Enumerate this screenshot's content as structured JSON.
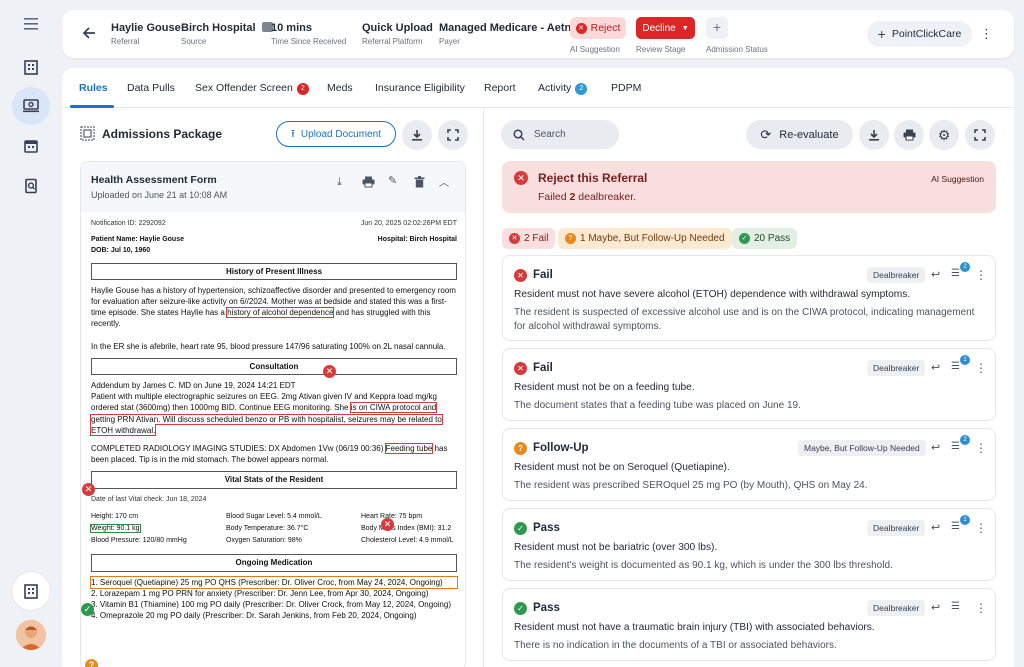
{
  "header": {
    "patient_name": "Haylie Gouse",
    "patient_label": "Referral",
    "hospital": "Birch Hospital",
    "hospital_label": "Source",
    "time": "10 mins",
    "time_label": "Time Since Received",
    "platform": "Quick Upload",
    "platform_label": "Referral Platform",
    "payer": "Managed Medicare - Aetna",
    "payer_label": "Payer",
    "ai_btn": "Reject",
    "ai_label": "AI Suggestion",
    "review_btn": "Decline",
    "review_label": "Review Stage",
    "admission_label": "Admission Status",
    "pcc_btn": "PointClickCare"
  },
  "tabs": [
    {
      "label": "Rules"
    },
    {
      "label": "Data Pulls"
    },
    {
      "label": "Sex Offender Screen",
      "badge": "2"
    },
    {
      "label": "Meds"
    },
    {
      "label": "Insurance Eligibility"
    },
    {
      "label": "Report"
    },
    {
      "label": "Activity",
      "badge": "2"
    },
    {
      "label": "PDPM"
    }
  ],
  "left": {
    "title": "Admissions Package",
    "upload_btn": "Upload Document",
    "doc_title": "Health Assessment Form",
    "doc_sub": "Uploaded on June 21 at 10:08 AM",
    "doc": {
      "notification": "Notification ID: 2292092",
      "datetime": "Jun 20, 2025 02:02:26PM EDT",
      "patient_name": "Patient Name: Haylie Gouse",
      "hospital": "Hospital: Birch Hospital",
      "dob": "DOB: Jul 10, 1960",
      "hpi_title": "History of Present Illness",
      "hpi_1": "Haylie Gouse has a history of hypertension, schizoaffective disorder and presented to emergency room for evaluation after seizure-like activity on 6/",
      "hpi_2": "/2024. Mother was at bedside and stated this was a first-time episode. She states Haylie has a",
      "hpi_hl": "history of alcohol dependence",
      "hpi_3": "and has struggled with this recently.",
      "hpi_4": "In the ER she is afebrile, heart rate 95, blood pressure 147/96 saturating 100% on 2L nasal cannula.",
      "cons_title": "Consultation",
      "cons_1": "Addendum by James C. MD on June 19, 2024 14:21 EDT",
      "cons_2": "Patient with multiple electrographic seizures on EEG. 2mg Ativan given IV and Keppra load",
      "cons_3": "mg/kg ordered stat (3600mg) then 1000mg BID. Continue EEG monitoring. She",
      "cons_hl": "is on CIWA protocol and getting PRN Ativan. Will discuss scheduled benzo or PB with hospitalist, seizures may be related to ETOH withdrawal.",
      "rad_1": "COMPLETED RADIOLOGY IMAGING STUDIES: DX Abdomen 1Vw (06/19 00:36)",
      "rad_hl": "Feeding tube",
      "rad_2": "has been placed. Tip is in the mid stomach. The bowel appears normal.",
      "vitals_title": "Vital Stats of the Resident",
      "vitals_date": "Date of last Vital check: Jun 18, 2024",
      "height": "Height: 170 cm",
      "blood_sugar": "Blood Sugar Level: 5.4 mmol/L",
      "heart_rate": "Heart Rate: 75 bpm",
      "weight": "Weight: 90.1 kg",
      "body_temp": "Body Temperature: 36.7°C",
      "bmi": "Body Mass Index (BMI): 31.2",
      "bp": "Blood Pressure: 120/80 mmHg",
      "o2": "Oxygen Saturation: 98%",
      "chol": "Cholesterol Level: 4.9 mmol/L",
      "meds_title": "Ongoing Medication",
      "med_1": "1. Seroquel (Quetiapine) 25 mg PO QHS (Prescriber: Dr. Oliver Croc, from May 24, 2024, Ongoing)",
      "med_2": "2. Lorazepam 1 mg PO PRN for anxiety (Prescriber: Dr. Jenn Lee, from Apr 30, 2024, Ongoing)",
      "med_3": "3. Vitamin B1 (Thiamine) 100 mg PO daily (Prescriber: Dr. Oliver Crock, from May 12, 2024, Ongoing)",
      "med_4": "4. Omeprazole 20 mg PO daily (Prescriber: Dr. Sarah Jenkins, from Feb 20, 2024, Ongoing)"
    }
  },
  "right": {
    "search_placeholder": "Search",
    "reeval_btn": "Re-evaluate",
    "banner_title": "Reject this Referral",
    "banner_sub_pre": "Failed ",
    "banner_sub_num": "2",
    "banner_sub_post": " dealbreaker.",
    "banner_tag": "AI Suggestion",
    "chips": [
      "2 Fail",
      "1 Maybe, But Follow-Up Needed",
      "20 Pass"
    ],
    "rules": [
      {
        "status": "Fail",
        "tag": "Dealbreaker",
        "count": "2",
        "rule": "Resident must not have severe alcohol (ETOH) dependence with withdrawal symptoms.",
        "explanation": "The resident is suspected of excessive alcohol use and is on the CIWA protocol, indicating management for alcohol withdrawal symptoms."
      },
      {
        "status": "Fail",
        "tag": "Dealbreaker",
        "count": "1",
        "rule": "Resident must not be on a feeding tube.",
        "explanation": "The document states that a feeding tube was placed on June 19."
      },
      {
        "status": "Follow-Up",
        "tag": "Maybe, But Follow-Up Needed",
        "count": "2",
        "rule": "Resident must not be on Seroquel (Quetiapine).",
        "explanation": "The resident was prescribed SEROquel 25 mg PO (by Mouth), QHS on May 24."
      },
      {
        "status": "Pass",
        "tag": "Dealbreaker",
        "count": "1",
        "rule": "Resident must not be bariatric (over 300 lbs).",
        "explanation": "The resident's weight is documented as 90.1 kg, which is under the 300 lbs threshold."
      },
      {
        "status": "Pass",
        "tag": "Dealbreaker",
        "rule": "Resident must not have a traumatic brain injury (TBI) with associated behaviors.",
        "explanation": "There is no indication in the documents of a TBI or associated behaviors."
      }
    ]
  },
  "colors": {
    "accent": "#1a73c8",
    "fail": "#d63b3b",
    "followup": "#e8891c",
    "pass": "#2e9a4e",
    "decline": "#dc2626"
  }
}
